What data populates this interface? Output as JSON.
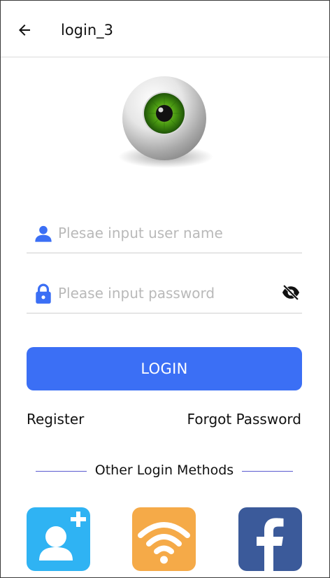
{
  "appbar": {
    "title": "login_3",
    "back_icon": "arrow-left-icon"
  },
  "logo": {
    "icon": "eye-logo",
    "iris_color": "#4a9a12"
  },
  "form": {
    "username": {
      "placeholder": "Plesae input user name",
      "value": "",
      "icon": "user-icon"
    },
    "password": {
      "placeholder": "Please input password",
      "value": "",
      "icon": "lock-icon",
      "visibility_icon": "visibility-off-icon"
    },
    "login_label": "LOGIN"
  },
  "links": {
    "register": "Register",
    "forgot_password": "Forgot Password"
  },
  "other_methods": {
    "label": "Other Login Methods",
    "items": [
      {
        "icon": "add-user-icon",
        "color": "#2fb3f3"
      },
      {
        "icon": "wifi-icon",
        "color": "#f5aa48"
      },
      {
        "icon": "facebook-icon",
        "color": "#3b5a9a"
      }
    ]
  },
  "colors": {
    "accent": "#3b6ff5",
    "icon_blue": "#3b6ff5",
    "divider": "#5b5bd0"
  }
}
